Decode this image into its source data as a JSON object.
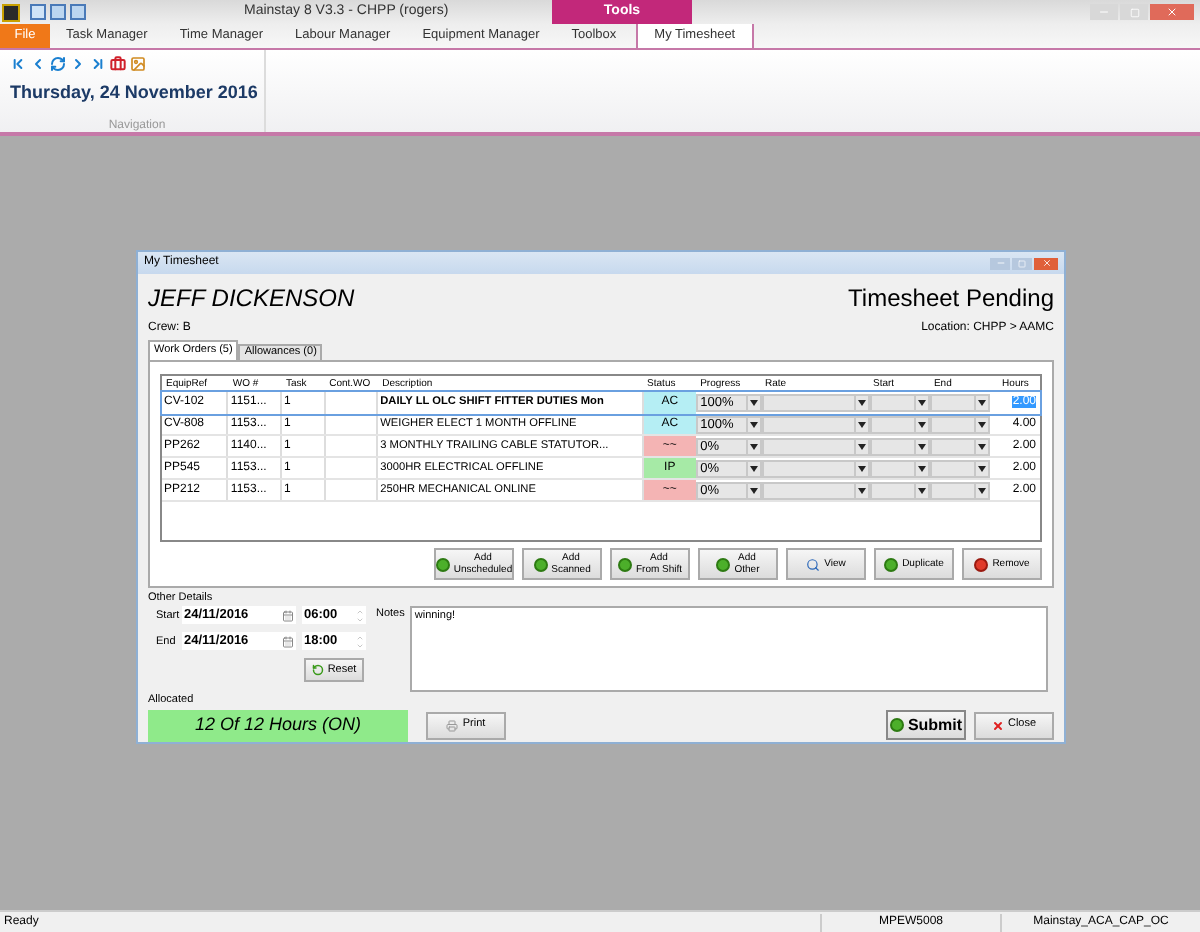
{
  "app": {
    "title": "Mainstay 8 V3.3 - CHPP (rogers)",
    "context_tab": "Tools"
  },
  "ribbon_tabs": [
    {
      "label": "File",
      "kind": "file",
      "selected": false
    },
    {
      "label": "Task Manager",
      "kind": "tab",
      "selected": false
    },
    {
      "label": "Time Manager",
      "kind": "tab",
      "selected": false
    },
    {
      "label": "Labour Manager",
      "kind": "tab",
      "selected": false
    },
    {
      "label": "Equipment Manager",
      "kind": "tab",
      "selected": false
    },
    {
      "label": "Toolbox",
      "kind": "tab",
      "selected": false
    },
    {
      "label": "My Timesheet",
      "kind": "tab",
      "selected": true
    }
  ],
  "navigation": {
    "date": "Thursday, 24 November 2016",
    "group_label": "Navigation"
  },
  "dialog": {
    "title": "My Timesheet",
    "employee": "JEFF DICKENSON",
    "state": "Timesheet Pending",
    "crew": "Crew: B",
    "location": "Location: CHPP > AAMC",
    "tabs": [
      {
        "label": "Work Orders (5)",
        "selected": true
      },
      {
        "label": "Allowances (0)",
        "selected": false
      }
    ],
    "table": {
      "columns": [
        "EquipRef",
        "WO #",
        "Task",
        "Cont.WO",
        "Description",
        "Status",
        "Progress",
        "Rate",
        "Start",
        "End",
        "Hours"
      ],
      "rows": [
        {
          "equip_ref": "CV-102",
          "wo": "1151...",
          "task": "1",
          "description": "DAILY LL OLC SHIFT FITTER DUTIES Mon",
          "status": "AC",
          "color": "#b5eef4",
          "progress": "100%",
          "hours": "2.00",
          "selected": true
        },
        {
          "equip_ref": "CV-808",
          "wo": "1153...",
          "task": "1",
          "description": "WEIGHER ELECT 1 MONTH OFFLINE",
          "status": "AC",
          "color": "#b5eef4",
          "progress": "100%",
          "hours": "4.00",
          "selected": false
        },
        {
          "equip_ref": "PP262",
          "wo": "1140...",
          "task": "1",
          "description": "3 MONTHLY TRAILING CABLE STATUTOR...",
          "status": "~~",
          "color": "#f4b4b4",
          "progress": "0%",
          "hours": "2.00",
          "selected": false
        },
        {
          "equip_ref": "PP545",
          "wo": "1153...",
          "task": "1",
          "description": "3000HR ELECTRICAL OFFLINE",
          "status": "IP",
          "color": "#a6eaa6",
          "progress": "0%",
          "hours": "2.00",
          "selected": false
        },
        {
          "equip_ref": "PP212",
          "wo": "1153...",
          "task": "1",
          "description": "250HR MECHANICAL ONLINE",
          "status": "~~",
          "color": "#f4b4b4",
          "progress": "0%",
          "hours": "2.00",
          "selected": false
        }
      ]
    },
    "actions": [
      {
        "lines": [
          "Add",
          "Unscheduled"
        ],
        "kind": "add"
      },
      {
        "lines": [
          "Add",
          "Scanned"
        ],
        "kind": "add"
      },
      {
        "lines": [
          "Add",
          "From Shift"
        ],
        "kind": "add"
      },
      {
        "lines": [
          "Add",
          "Other"
        ],
        "kind": "add"
      },
      {
        "lines": [
          "View"
        ],
        "kind": "view"
      },
      {
        "lines": [
          "Duplicate"
        ],
        "kind": "add"
      },
      {
        "lines": [
          "Remove"
        ],
        "kind": "remove"
      }
    ],
    "other_details": {
      "label": "Other Details",
      "start": {
        "label": "Start",
        "date": "24/11/2016",
        "time": "06:00"
      },
      "end": {
        "label": "End",
        "date": "24/11/2016",
        "time": "18:00"
      },
      "reset": "Reset",
      "notes_label": "Notes",
      "notes": "winning!"
    },
    "allocated": {
      "label": "Allocated",
      "value": "12 Of 12 Hours (ON)"
    },
    "buttons": {
      "print": "Print",
      "submit": "Submit",
      "close": "Close"
    }
  },
  "status_bar": [
    "Ready",
    "MPEW5008",
    "Mainstay_ACA_CAP_OC"
  ]
}
